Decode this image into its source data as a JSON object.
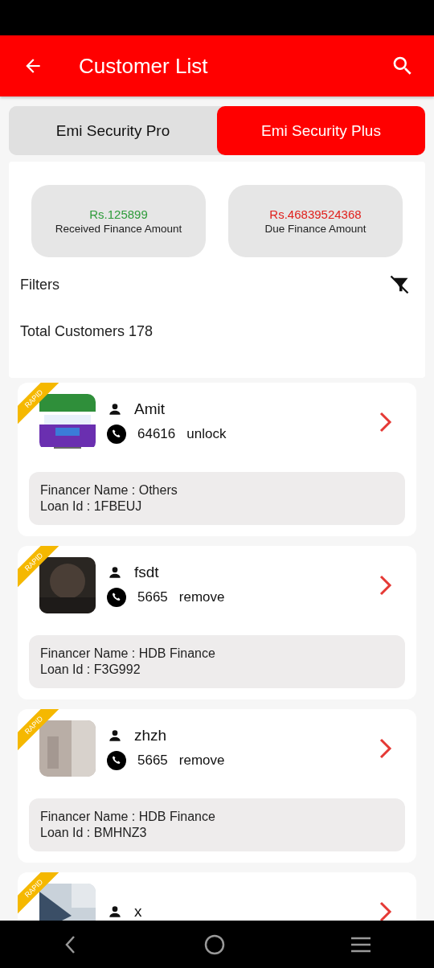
{
  "app_bar": {
    "title": "Customer List"
  },
  "tabs": [
    {
      "label": "Emi Security Pro",
      "selected": false
    },
    {
      "label": "Emi Security Plus",
      "selected": true
    }
  ],
  "summary": [
    {
      "amount": "Rs.125899",
      "label": "Received Finance Amount",
      "color": "#2e9b3a"
    },
    {
      "amount": "Rs.46839524368",
      "label": "Due Finance Amount",
      "color": "#e0201c"
    }
  ],
  "filters": {
    "label": "Filters"
  },
  "total": "Total Customers 178",
  "customers": [
    {
      "badge": "RAPID",
      "name": "Amit",
      "phone": "64616",
      "status": "unlock",
      "financer": "Financer Name : Others",
      "loan": "Loan Id : 1FBEUJ"
    },
    {
      "badge": "RAPID",
      "name": "fsdt",
      "phone": "5665",
      "status": "remove",
      "financer": "Financer Name : HDB Finance",
      "loan": "Loan Id : F3G992"
    },
    {
      "badge": "RAPID",
      "name": "zhzh",
      "phone": "5665",
      "status": "remove",
      "financer": "Financer Name : HDB Finance",
      "loan": "Loan Id : BMHNZ3"
    },
    {
      "badge": "RAPID",
      "name": "x"
    }
  ]
}
